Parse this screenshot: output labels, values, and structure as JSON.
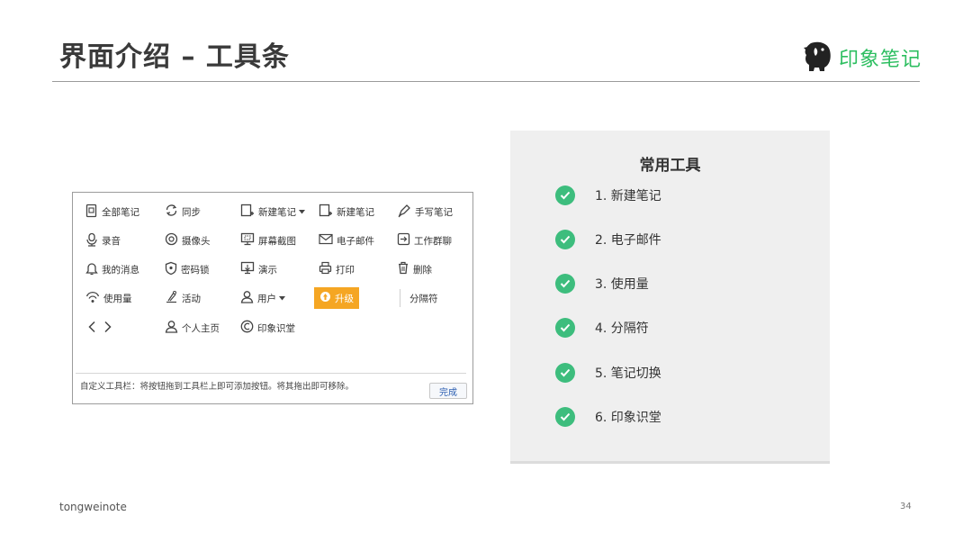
{
  "slide": {
    "title": "界面介绍 – 工具条",
    "brand_name": "印象笔记",
    "footer_left": "tongweinote",
    "page_number": "34",
    "accent_color": "#2dbe60"
  },
  "toolbar_panel": {
    "items": [
      {
        "label": "全部笔记",
        "icon": "all-notes-icon"
      },
      {
        "label": "同步",
        "icon": "sync-icon"
      },
      {
        "label": "新建笔记",
        "icon": "new-note-dropdown-icon",
        "dropdown": true
      },
      {
        "label": "新建笔记",
        "icon": "new-note-icon"
      },
      {
        "label": "手写笔记",
        "icon": "handwriting-icon"
      },
      {
        "label": "录音",
        "icon": "microphone-icon"
      },
      {
        "label": "摄像头",
        "icon": "camera-icon"
      },
      {
        "label": "屏幕截图",
        "icon": "screenshot-icon"
      },
      {
        "label": "电子邮件",
        "icon": "email-icon"
      },
      {
        "label": "工作群聊",
        "icon": "work-chat-icon"
      },
      {
        "label": "我的消息",
        "icon": "bell-icon"
      },
      {
        "label": "密码锁",
        "icon": "lock-icon"
      },
      {
        "label": "演示",
        "icon": "presentation-icon"
      },
      {
        "label": "打印",
        "icon": "printer-icon"
      },
      {
        "label": "删除",
        "icon": "trash-icon"
      },
      {
        "label": "使用量",
        "icon": "usage-icon"
      },
      {
        "label": "活动",
        "icon": "activity-icon"
      },
      {
        "label": "用户",
        "icon": "user-icon",
        "dropdown": true
      },
      {
        "label": "升级",
        "icon": "upgrade-icon"
      },
      {
        "label": "分隔符",
        "icon": ""
      },
      {
        "label": "",
        "icon": "back-forward-icon"
      },
      {
        "label": "个人主页",
        "icon": "profile-icon"
      },
      {
        "label": "印象识堂",
        "icon": "yinxiang-class-icon"
      }
    ],
    "hint": "自定义工具栏：将按钮拖到工具栏上即可添加按钮。将其拖出即可移除。",
    "done_label": "完成"
  },
  "common_tools": {
    "heading": "常用工具",
    "items": [
      "1. 新建笔记",
      "2. 电子邮件",
      "3. 使用量",
      "4. 分隔符",
      "5. 笔记切换",
      "6. 印象识堂"
    ],
    "check_color": "#3dbd7d"
  }
}
